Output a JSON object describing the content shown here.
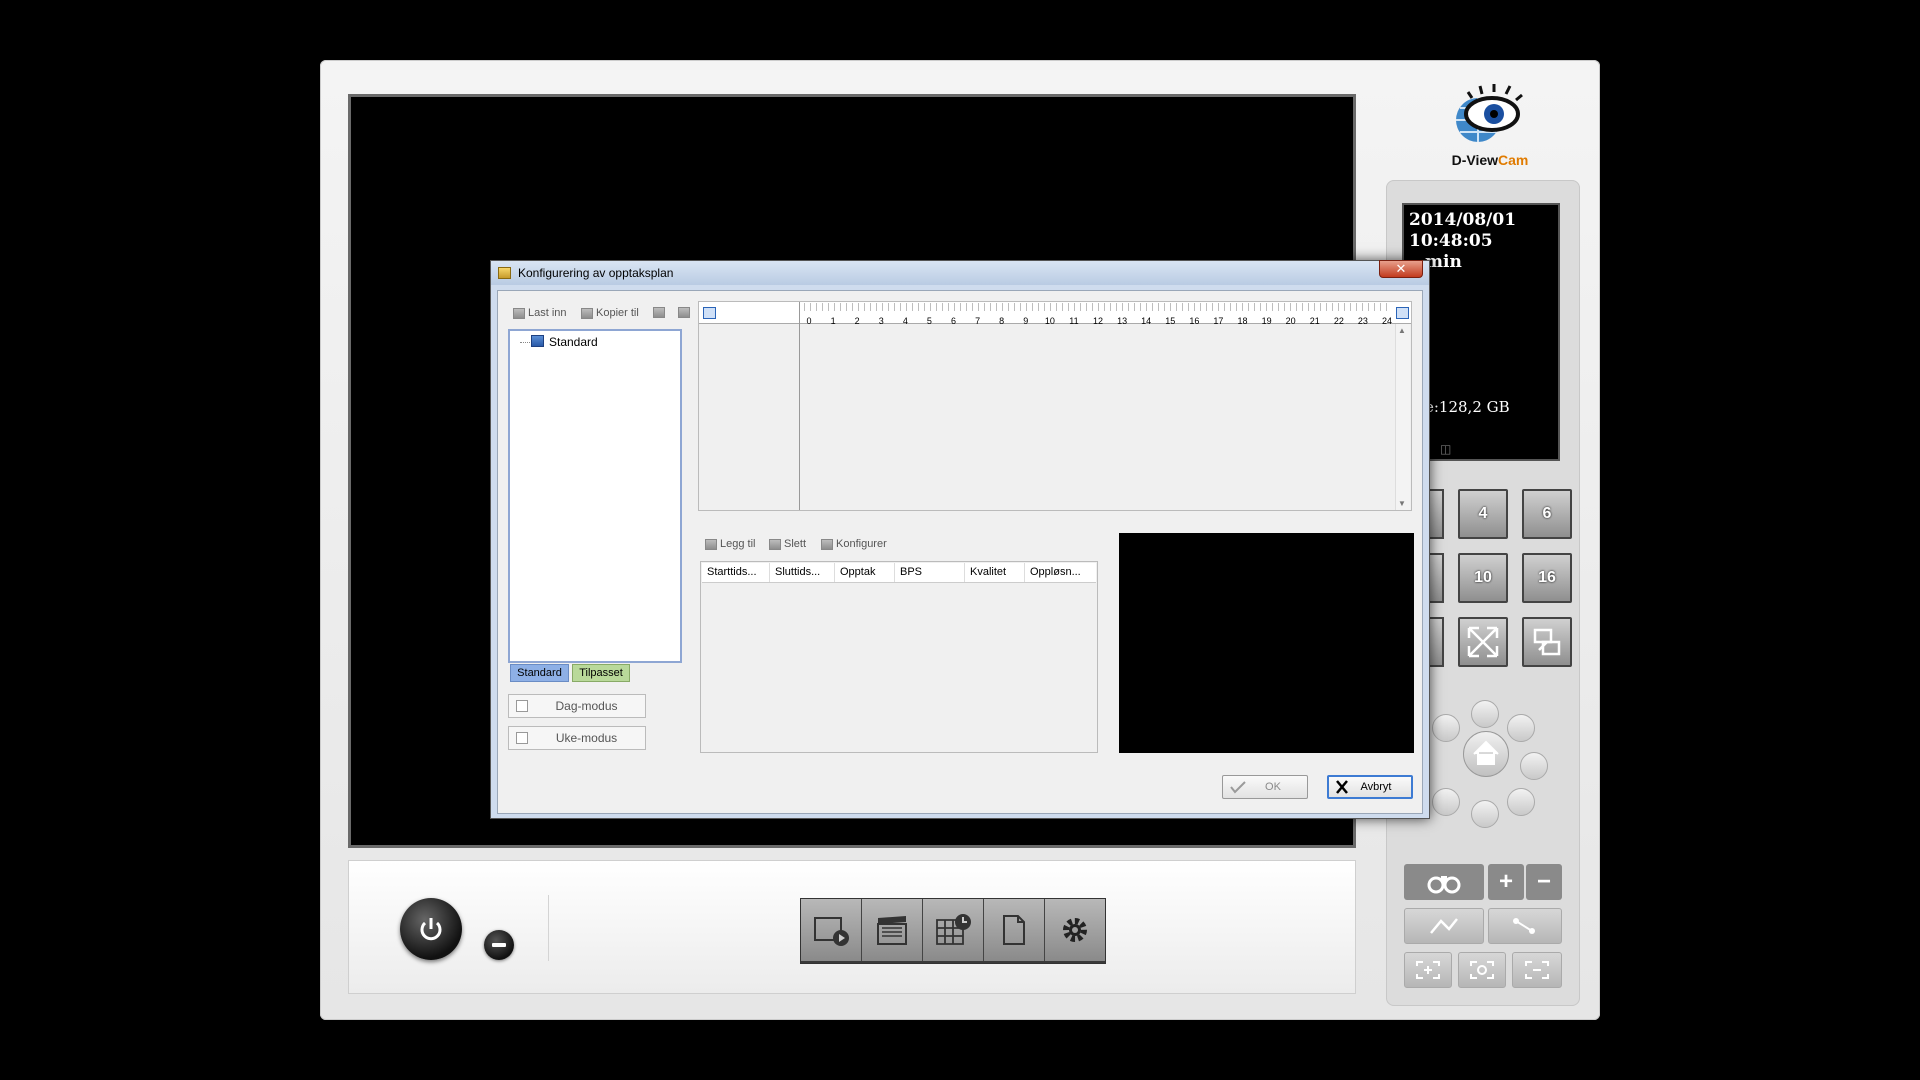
{
  "app": {
    "logo_text_a": "D-View",
    "logo_text_b": "Cam",
    "info": {
      "date": "2014/08/01",
      "time": "10:48:05",
      "user": "min",
      "disk": "e:128,2 GB"
    },
    "layouts": [
      "4",
      "6",
      "10",
      "16"
    ],
    "toolbar_icons": [
      "playback-icon",
      "clapperboard-icon",
      "schedule-grid-icon",
      "document-icon",
      "gear-icon"
    ]
  },
  "dialog": {
    "title": "Konfigurering av opptaksplan",
    "close_label": "✕",
    "left_toolbar": {
      "load_label": "Last inn",
      "copy_label": "Kopier til"
    },
    "tree": {
      "root_label": "Standard"
    },
    "tabs": {
      "standard": "Standard",
      "custom": "Tilpasset"
    },
    "modes": {
      "day": "Dag-modus",
      "week": "Uke-modus"
    },
    "timeline": {
      "hours": [
        "0",
        "1",
        "2",
        "3",
        "4",
        "5",
        "6",
        "7",
        "8",
        "9",
        "10",
        "11",
        "12",
        "13",
        "14",
        "15",
        "16",
        "17",
        "18",
        "19",
        "20",
        "21",
        "22",
        "23",
        "24"
      ]
    },
    "table_toolbar": {
      "add_label": "Legg til",
      "delete_label": "Slett",
      "configure_label": "Konfigurer"
    },
    "table": {
      "columns": [
        "Starttids...",
        "Sluttids...",
        "Opptak",
        "BPS",
        "Kvalitet",
        "Oppløsn..."
      ]
    },
    "buttons": {
      "ok": "OK",
      "cancel": "Avbryt"
    }
  },
  "colors": {
    "tab_standard": "#8eb0e6",
    "tab_custom": "#b9d99a",
    "accent_orange": "#e07b00"
  }
}
